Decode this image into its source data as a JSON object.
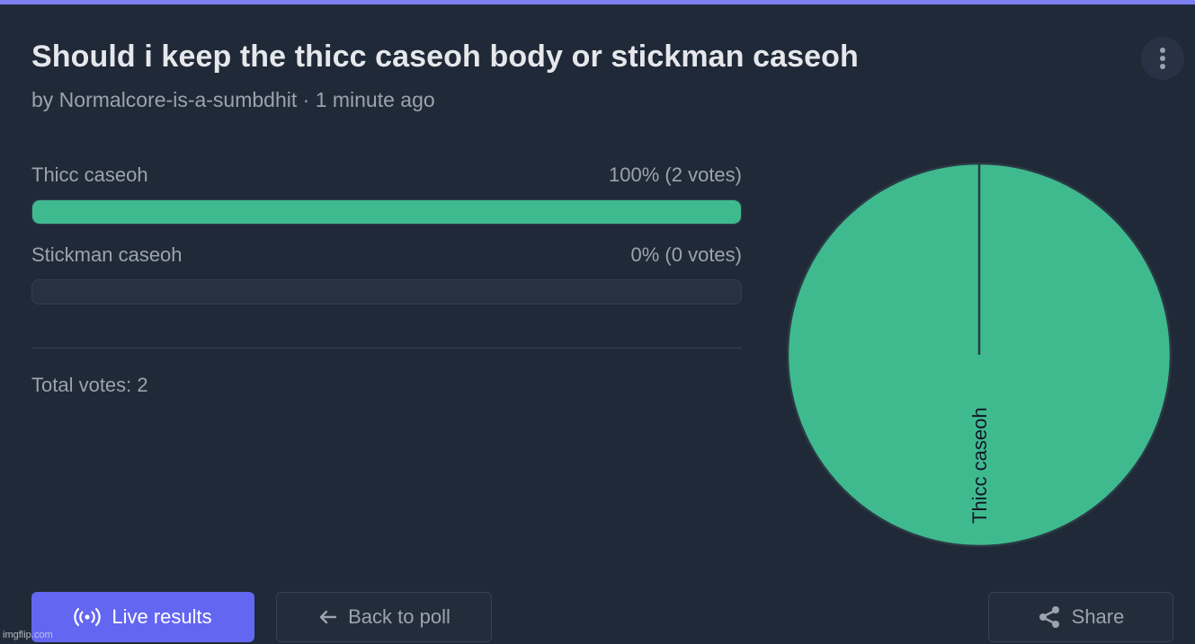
{
  "poll": {
    "title": "Should i keep the thicc caseoh body or stickman caseoh",
    "byline": "by Normalcore-is-a-sumbdhit · 1 minute ago",
    "options": [
      {
        "label": "Thicc caseoh",
        "result": "100% (2 votes)",
        "fraction": 1.0
      },
      {
        "label": "Stickman caseoh",
        "result": "0% (0 votes)",
        "fraction": 0.0
      }
    ],
    "total": "Total votes: 2"
  },
  "chart_data": {
    "type": "pie",
    "categories": [
      "Thicc caseoh",
      "Stickman caseoh"
    ],
    "values": [
      2,
      0
    ],
    "slice_labels": [
      "Thicc caseoh"
    ]
  },
  "buttons": {
    "live": "Live results",
    "back": "Back to poll",
    "share": "Share"
  },
  "icons": {
    "menu": "more-vertical-icon",
    "live": "broadcast-icon",
    "back": "arrow-left-icon",
    "share": "share-icon"
  },
  "colors": {
    "accent": "#6366f1",
    "bar_fill": "#3fba8f",
    "background": "#1f2937"
  },
  "watermark": "imgflip.com"
}
